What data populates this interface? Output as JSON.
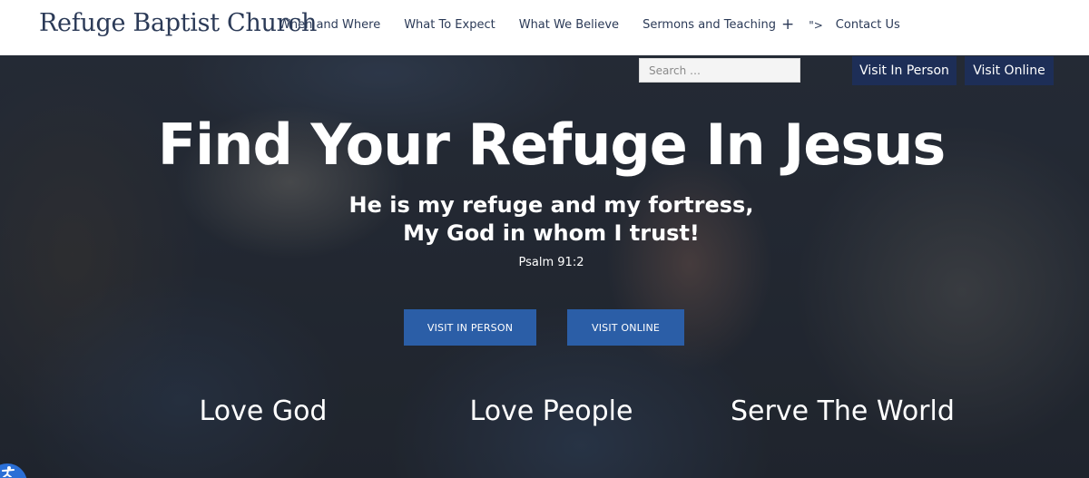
{
  "header": {
    "logo": "Refuge Baptist Church",
    "nav": [
      "When and Where",
      "What To Expect",
      "What We Believe",
      "Sermons and Teaching"
    ],
    "stray_text": "\">",
    "contact": "Contact Us"
  },
  "hero": {
    "search_placeholder": "Search …",
    "top_buttons": {
      "visit_in_person": "Visit In Person",
      "visit_online": "Visit Online"
    },
    "title": "Find Your Refuge In Jesus",
    "verse_line1": "He is my refuge and my fortress,",
    "verse_line2": "My God in whom I trust!",
    "verse_ref": "Psalm 91:2",
    "cta": {
      "visit_in_person": "VISIT IN PERSON",
      "visit_online": "VISIT ONLINE"
    },
    "pillars": [
      "Love God",
      "Love People",
      "Serve The World"
    ]
  },
  "colors": {
    "navy": "#1d2e57",
    "cta_blue": "#2b5ea7",
    "text_dark": "#2b3a57"
  },
  "icons": [
    "plus-icon",
    "accessibility-icon"
  ]
}
